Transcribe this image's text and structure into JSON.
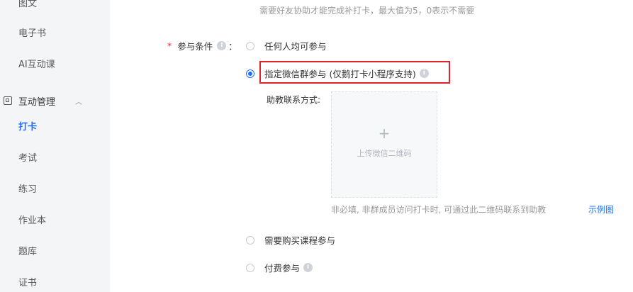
{
  "sidebar": {
    "items_top": [
      {
        "label": "图文"
      },
      {
        "label": "电子书"
      },
      {
        "label": "AI互动课"
      }
    ],
    "group": {
      "label": "互动管理"
    },
    "items_group": [
      {
        "label": "打卡",
        "active": true
      },
      {
        "label": "考试"
      },
      {
        "label": "练习"
      },
      {
        "label": "作业本"
      },
      {
        "label": "题库"
      },
      {
        "label": "证书"
      }
    ]
  },
  "form": {
    "top_hint": "需要好友协助才能完成补打卡，最大值为5，0表示不需要",
    "condition_label": "参与条件",
    "colon": "：",
    "required_mark": "*",
    "options": [
      {
        "label": "任何人均可参与",
        "checked": false
      },
      {
        "label": "指定微信群参与 (仅鹅打卡小程序支持)",
        "checked": true
      },
      {
        "label": "需要购买课程参与",
        "checked": false
      },
      {
        "label": "付费参与",
        "checked": false
      }
    ],
    "assistant_label": "助教联系方式:",
    "upload": {
      "plus": "+",
      "text": "上传微信二维码"
    },
    "upload_hint": "非必填, 非群成员访问打卡时, 可通过此二维码联系到助教",
    "example_link": "示例图"
  },
  "colors": {
    "accent": "#1e6fff",
    "highlight": "#e0242c",
    "sidebar_bg": "#f4f5f7"
  },
  "icons": {
    "info": "info-icon",
    "collapse": "chevron-up-icon",
    "group": "interactive-management-icon"
  }
}
